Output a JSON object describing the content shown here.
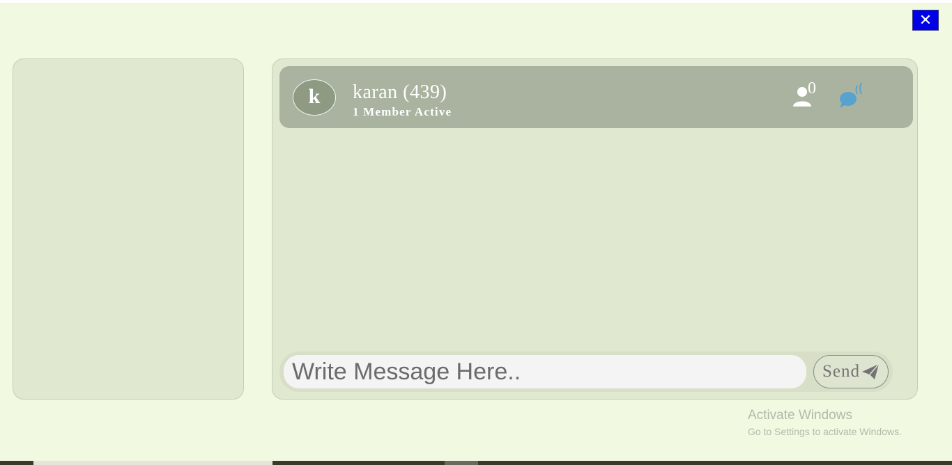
{
  "window": {
    "close_label": "✕"
  },
  "chat": {
    "avatar_letter": "k",
    "name": "karan (439)",
    "status": "1 Member Active",
    "members_count": "0",
    "icons": {
      "members": "user-icon",
      "notify": "chat-notification-icon"
    }
  },
  "composer": {
    "placeholder": "Write Message Here..",
    "send_label": "Send",
    "send_icon": "paper-plane-icon"
  },
  "watermark": {
    "title": "Activate Windows",
    "subtitle": "Go to Settings to activate Windows."
  },
  "colors": {
    "background": "#f1f9e0",
    "panel": "#e0e9cf",
    "header": "#aab3a0",
    "close_button": "#0000e6",
    "notify_icon": "#4a9fd8"
  }
}
